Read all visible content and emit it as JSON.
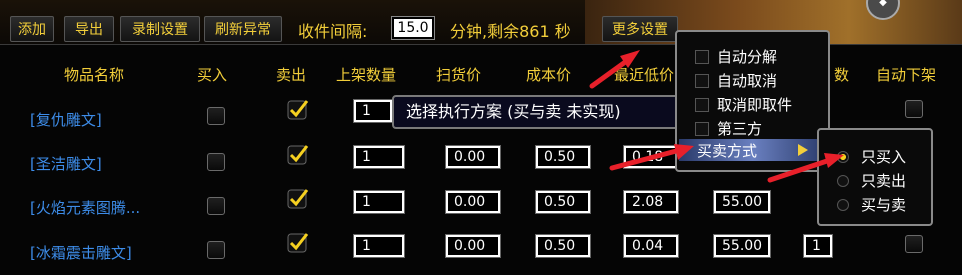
{
  "toolbar": {
    "add": "添加",
    "export": "导出",
    "record_settings": "录制设置",
    "refresh_errors": "刷新异常",
    "interval_label": "收件间隔:",
    "interval_value": "15.0",
    "remaining": "分钟,剩余861 秒",
    "more_settings": "更多设置"
  },
  "headers": {
    "item_name": "物品名称",
    "buy": "买入",
    "sell": "卖出",
    "list_qty": "上架数量",
    "sweep_price": "扫货价",
    "cost_price": "成本价",
    "recent_low": "最近低价",
    "count_tail": "数",
    "auto_delist": "自动下架"
  },
  "rows": [
    {
      "name": "[复仇雕文]",
      "buy": false,
      "sell": true,
      "qty": "1",
      "sweep": "",
      "cost": "",
      "low": "",
      "col5": "",
      "count": ""
    },
    {
      "name": "[圣洁雕文]",
      "buy": false,
      "sell": true,
      "qty": "1",
      "sweep": "0.00",
      "cost": "0.50",
      "low": "0.18",
      "col5": "",
      "count": ""
    },
    {
      "name": "[火焰元素图腾...",
      "buy": false,
      "sell": true,
      "qty": "1",
      "sweep": "0.00",
      "cost": "0.50",
      "low": "2.08",
      "col5": "55.00",
      "count": ""
    },
    {
      "name": "[冰霜震击雕文]",
      "buy": false,
      "sell": true,
      "qty": "1",
      "sweep": "0.00",
      "cost": "0.50",
      "low": "0.04",
      "col5": "55.00",
      "count": "1"
    }
  ],
  "menu": {
    "items": [
      "自动分解",
      "自动取消",
      "取消即取件",
      "第三方"
    ],
    "trade_mode": "买卖方式",
    "submenu": [
      "只买入",
      "只卖出",
      "买与卖"
    ],
    "selected": "只买入"
  },
  "tooltip": "选择执行方案 (买与卖 未实现)",
  "colors": {
    "accent": "#f2ce3a",
    "link": "#3d8ce8",
    "arrow": "#e8202a",
    "highlight": "#6a80c0"
  }
}
